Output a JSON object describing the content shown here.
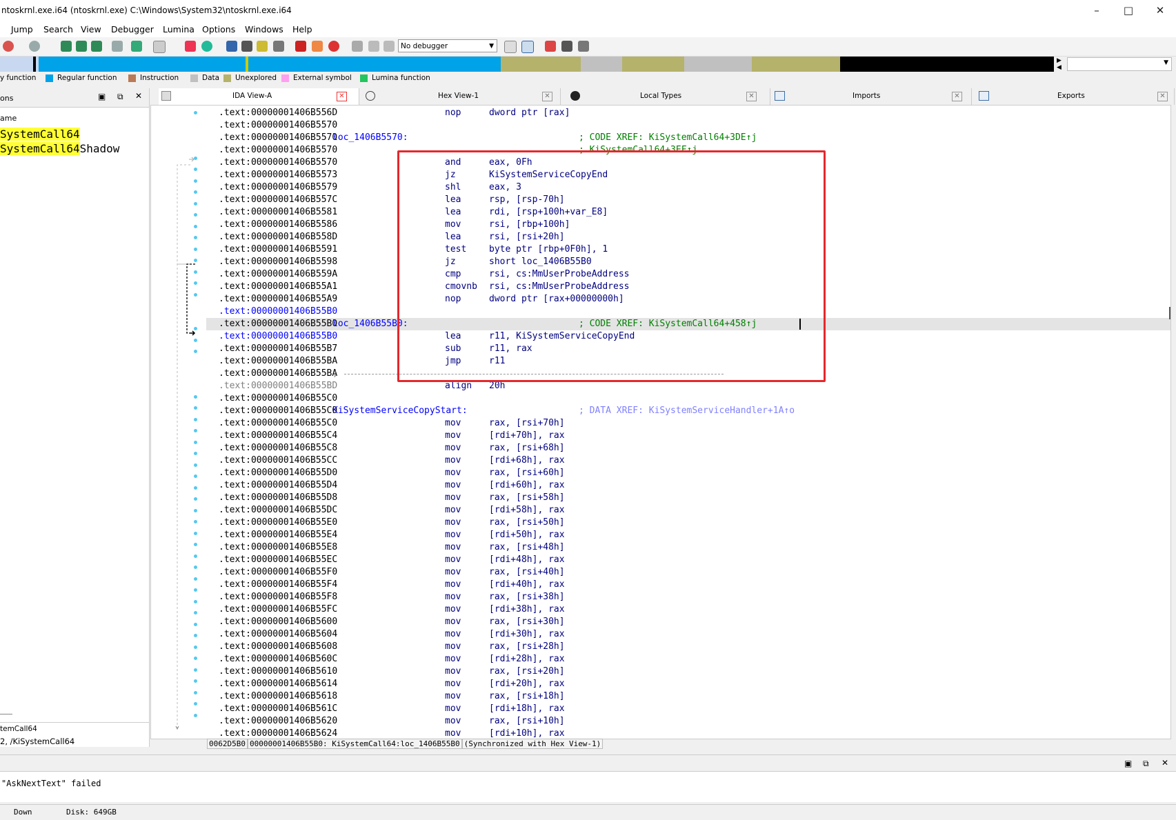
{
  "window": {
    "title": "ntoskrnl.exe.i64 (ntoskrnl.exe) C:\\Windows\\System32\\ntoskrnl.exe.i64",
    "controls": [
      "minimize",
      "maximize",
      "close"
    ]
  },
  "menu": [
    "Jump",
    "Search",
    "View",
    "Debugger",
    "Lumina",
    "Options",
    "Windows",
    "Help"
  ],
  "toolbar": {
    "debugger_select": "No debugger"
  },
  "legend": [
    {
      "label": "y function",
      "color": "#c8d8f0"
    },
    {
      "label": "Regular function",
      "color": "#00a2e8"
    },
    {
      "label": "Instruction",
      "color": "#b97a57"
    },
    {
      "label": "Data",
      "color": "#c0c0c0"
    },
    {
      "label": "Unexplored",
      "color": "#b5b26b"
    },
    {
      "label": "External symbol",
      "color": "#ff9ff0"
    },
    {
      "label": "Lumina function",
      "color": "#22c55e"
    }
  ],
  "left_panel": {
    "title": "ons",
    "column_header": "ame",
    "items": [
      {
        "highlight": "SystemCall64",
        "rest": ""
      },
      {
        "highlight": "SystemCall64",
        "rest": "Shadow"
      }
    ],
    "footer1": "temCall64",
    "footer2": "2, /KiSystemCall64"
  },
  "tabs": [
    {
      "label": "IDA View-A",
      "icon": "ida-view-icon",
      "active": true
    },
    {
      "label": "Hex View-1",
      "icon": "hex-view-icon",
      "active": false
    },
    {
      "label": "Local Types",
      "icon": "local-types-icon",
      "active": false
    },
    {
      "label": "Imports",
      "icon": "imports-icon",
      "active": false
    },
    {
      "label": "Exports",
      "icon": "exports-icon",
      "active": false
    }
  ],
  "code_lines": [
    {
      "addr": ".text:00000001406B556D",
      "label": "",
      "mn": "nop",
      "op": "dword ptr [rax]",
      "comment": ""
    },
    {
      "addr": ".text:00000001406B5570",
      "label": "",
      "mn": "",
      "op": "",
      "comment": ""
    },
    {
      "addr": ".text:00000001406B5570",
      "label": "loc_1406B5570:",
      "mn": "",
      "op": "",
      "comment": "; CODE XREF: KiSystemCall64+3DE↑j"
    },
    {
      "addr": ".text:00000001406B5570",
      "label": "",
      "mn": "",
      "op": "",
      "comment": "; KiSystemCall64+3EF↑j"
    },
    {
      "addr": ".text:00000001406B5570",
      "label": "",
      "mn": "and",
      "op": "eax, 0Fh",
      "comment": ""
    },
    {
      "addr": ".text:00000001406B5573",
      "label": "",
      "mn": "jz",
      "op": "KiSystemServiceCopyEnd",
      "comment": ""
    },
    {
      "addr": ".text:00000001406B5579",
      "label": "",
      "mn": "shl",
      "op": "eax, 3",
      "comment": ""
    },
    {
      "addr": ".text:00000001406B557C",
      "label": "",
      "mn": "lea",
      "op": "rsp, [rsp-70h]",
      "comment": ""
    },
    {
      "addr": ".text:00000001406B5581",
      "label": "",
      "mn": "lea",
      "op": "rdi, [rsp+100h+var_E8]",
      "comment": ""
    },
    {
      "addr": ".text:00000001406B5586",
      "label": "",
      "mn": "mov",
      "op": "rsi, [rbp+100h]",
      "comment": ""
    },
    {
      "addr": ".text:00000001406B558D",
      "label": "",
      "mn": "lea",
      "op": "rsi, [rsi+20h]",
      "comment": ""
    },
    {
      "addr": ".text:00000001406B5591",
      "label": "",
      "mn": "test",
      "op": "byte ptr [rbp+0F0h], 1",
      "comment": ""
    },
    {
      "addr": ".text:00000001406B5598",
      "label": "",
      "mn": "jz",
      "op": "short loc_1406B55B0",
      "comment": ""
    },
    {
      "addr": ".text:00000001406B559A",
      "label": "",
      "mn": "cmp",
      "op": "rsi, cs:MmUserProbeAddress",
      "comment": ""
    },
    {
      "addr": ".text:00000001406B55A1",
      "label": "",
      "mn": "cmovnb",
      "op": "rsi, cs:MmUserProbeAddress",
      "comment": ""
    },
    {
      "addr": ".text:00000001406B55A9",
      "label": "",
      "mn": "nop",
      "op": "dword ptr [rax+00000000h]",
      "comment": ""
    },
    {
      "addr": ".text:00000001406B55B0",
      "label": "",
      "mn": "",
      "op": "",
      "comment": "",
      "addr_style": "blue"
    },
    {
      "addr": ".text:00000001406B55B0",
      "label": "loc_1406B55B0:",
      "mn": "",
      "op": "",
      "comment": "; CODE XREF: KiSystemCall64+458↑j",
      "current": true
    },
    {
      "addr": ".text:00000001406B55B0",
      "label": "",
      "mn": "lea",
      "op": "r11, KiSystemServiceCopyEnd",
      "comment": "",
      "addr_style": "blue"
    },
    {
      "addr": ".text:00000001406B55B7",
      "label": "",
      "mn": "sub",
      "op": "r11, rax",
      "comment": ""
    },
    {
      "addr": ".text:00000001406B55BA",
      "label": "",
      "mn": "jmp",
      "op": "r11",
      "comment": ""
    },
    {
      "addr": ".text:00000001406B55BA",
      "label": ";",
      "mn": "",
      "op": "",
      "comment": "",
      "separator": true
    },
    {
      "addr": ".text:00000001406B55BD",
      "label": "",
      "mn": "align",
      "op": "20h",
      "comment": "",
      "addr_style": "grey"
    },
    {
      "addr": ".text:00000001406B55C0",
      "label": "",
      "mn": "",
      "op": "",
      "comment": ""
    },
    {
      "addr": ".text:00000001406B55C0",
      "label": "KiSystemServiceCopyStart:",
      "mn": "",
      "op": "",
      "comment": "; DATA XREF: KiSystemServiceHandler+1A↑o",
      "comment_style": "data"
    },
    {
      "addr": ".text:00000001406B55C0",
      "label": "",
      "mn": "mov",
      "op": "rax, [rsi+70h]",
      "comment": ""
    },
    {
      "addr": ".text:00000001406B55C4",
      "label": "",
      "mn": "mov",
      "op": "[rdi+70h], rax",
      "comment": ""
    },
    {
      "addr": ".text:00000001406B55C8",
      "label": "",
      "mn": "mov",
      "op": "rax, [rsi+68h]",
      "comment": ""
    },
    {
      "addr": ".text:00000001406B55CC",
      "label": "",
      "mn": "mov",
      "op": "[rdi+68h], rax",
      "comment": ""
    },
    {
      "addr": ".text:00000001406B55D0",
      "label": "",
      "mn": "mov",
      "op": "rax, [rsi+60h]",
      "comment": ""
    },
    {
      "addr": ".text:00000001406B55D4",
      "label": "",
      "mn": "mov",
      "op": "[rdi+60h], rax",
      "comment": ""
    },
    {
      "addr": ".text:00000001406B55D8",
      "label": "",
      "mn": "mov",
      "op": "rax, [rsi+58h]",
      "comment": ""
    },
    {
      "addr": ".text:00000001406B55DC",
      "label": "",
      "mn": "mov",
      "op": "[rdi+58h], rax",
      "comment": ""
    },
    {
      "addr": ".text:00000001406B55E0",
      "label": "",
      "mn": "mov",
      "op": "rax, [rsi+50h]",
      "comment": ""
    },
    {
      "addr": ".text:00000001406B55E4",
      "label": "",
      "mn": "mov",
      "op": "[rdi+50h], rax",
      "comment": ""
    },
    {
      "addr": ".text:00000001406B55E8",
      "label": "",
      "mn": "mov",
      "op": "rax, [rsi+48h]",
      "comment": ""
    },
    {
      "addr": ".text:00000001406B55EC",
      "label": "",
      "mn": "mov",
      "op": "[rdi+48h], rax",
      "comment": ""
    },
    {
      "addr": ".text:00000001406B55F0",
      "label": "",
      "mn": "mov",
      "op": "rax, [rsi+40h]",
      "comment": ""
    },
    {
      "addr": ".text:00000001406B55F4",
      "label": "",
      "mn": "mov",
      "op": "[rdi+40h], rax",
      "comment": ""
    },
    {
      "addr": ".text:00000001406B55F8",
      "label": "",
      "mn": "mov",
      "op": "rax, [rsi+38h]",
      "comment": ""
    },
    {
      "addr": ".text:00000001406B55FC",
      "label": "",
      "mn": "mov",
      "op": "[rdi+38h], rax",
      "comment": ""
    },
    {
      "addr": ".text:00000001406B5600",
      "label": "",
      "mn": "mov",
      "op": "rax, [rsi+30h]",
      "comment": ""
    },
    {
      "addr": ".text:00000001406B5604",
      "label": "",
      "mn": "mov",
      "op": "[rdi+30h], rax",
      "comment": ""
    },
    {
      "addr": ".text:00000001406B5608",
      "label": "",
      "mn": "mov",
      "op": "rax, [rsi+28h]",
      "comment": ""
    },
    {
      "addr": ".text:00000001406B560C",
      "label": "",
      "mn": "mov",
      "op": "[rdi+28h], rax",
      "comment": ""
    },
    {
      "addr": ".text:00000001406B5610",
      "label": "",
      "mn": "mov",
      "op": "rax, [rsi+20h]",
      "comment": ""
    },
    {
      "addr": ".text:00000001406B5614",
      "label": "",
      "mn": "mov",
      "op": "[rdi+20h], rax",
      "comment": ""
    },
    {
      "addr": ".text:00000001406B5618",
      "label": "",
      "mn": "mov",
      "op": "rax, [rsi+18h]",
      "comment": ""
    },
    {
      "addr": ".text:00000001406B561C",
      "label": "",
      "mn": "mov",
      "op": "[rdi+18h], rax",
      "comment": ""
    },
    {
      "addr": ".text:00000001406B5620",
      "label": "",
      "mn": "mov",
      "op": "rax, [rsi+10h]",
      "comment": ""
    },
    {
      "addr": ".text:00000001406B5624",
      "label": "",
      "mn": "mov",
      "op": "[rdi+10h], rax",
      "comment": ""
    }
  ],
  "status_line": [
    "0062D5B0",
    "00000001406B55B0: KiSystemCall64:loc_1406B55B0",
    "(Synchronized with Hex View-1)"
  ],
  "output": {
    "message": "\"AskNextText\" failed"
  },
  "statusbar": {
    "state": "Down",
    "disk": "Disk: 649GB"
  }
}
